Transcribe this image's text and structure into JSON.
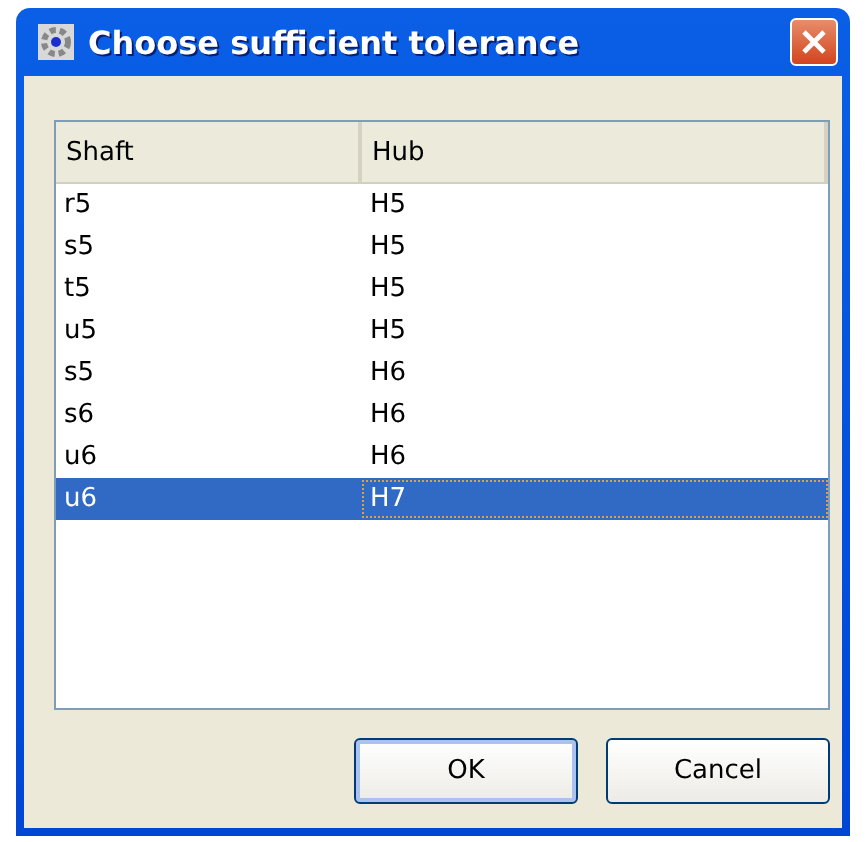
{
  "window": {
    "title": "Choose sufficient tolerance"
  },
  "table": {
    "columns": [
      "Shaft",
      "Hub"
    ],
    "rows": [
      {
        "cells": [
          "r5",
          "H5"
        ],
        "selected": false
      },
      {
        "cells": [
          "s5",
          "H5"
        ],
        "selected": false
      },
      {
        "cells": [
          "t5",
          "H5"
        ],
        "selected": false
      },
      {
        "cells": [
          "u5",
          "H5"
        ],
        "selected": false
      },
      {
        "cells": [
          "s5",
          "H6"
        ],
        "selected": false
      },
      {
        "cells": [
          "s6",
          "H6"
        ],
        "selected": false
      },
      {
        "cells": [
          "u6",
          "H6"
        ],
        "selected": false
      },
      {
        "cells": [
          "u6",
          "H7"
        ],
        "selected": true
      }
    ]
  },
  "buttons": [
    "OK",
    "Cancel"
  ]
}
